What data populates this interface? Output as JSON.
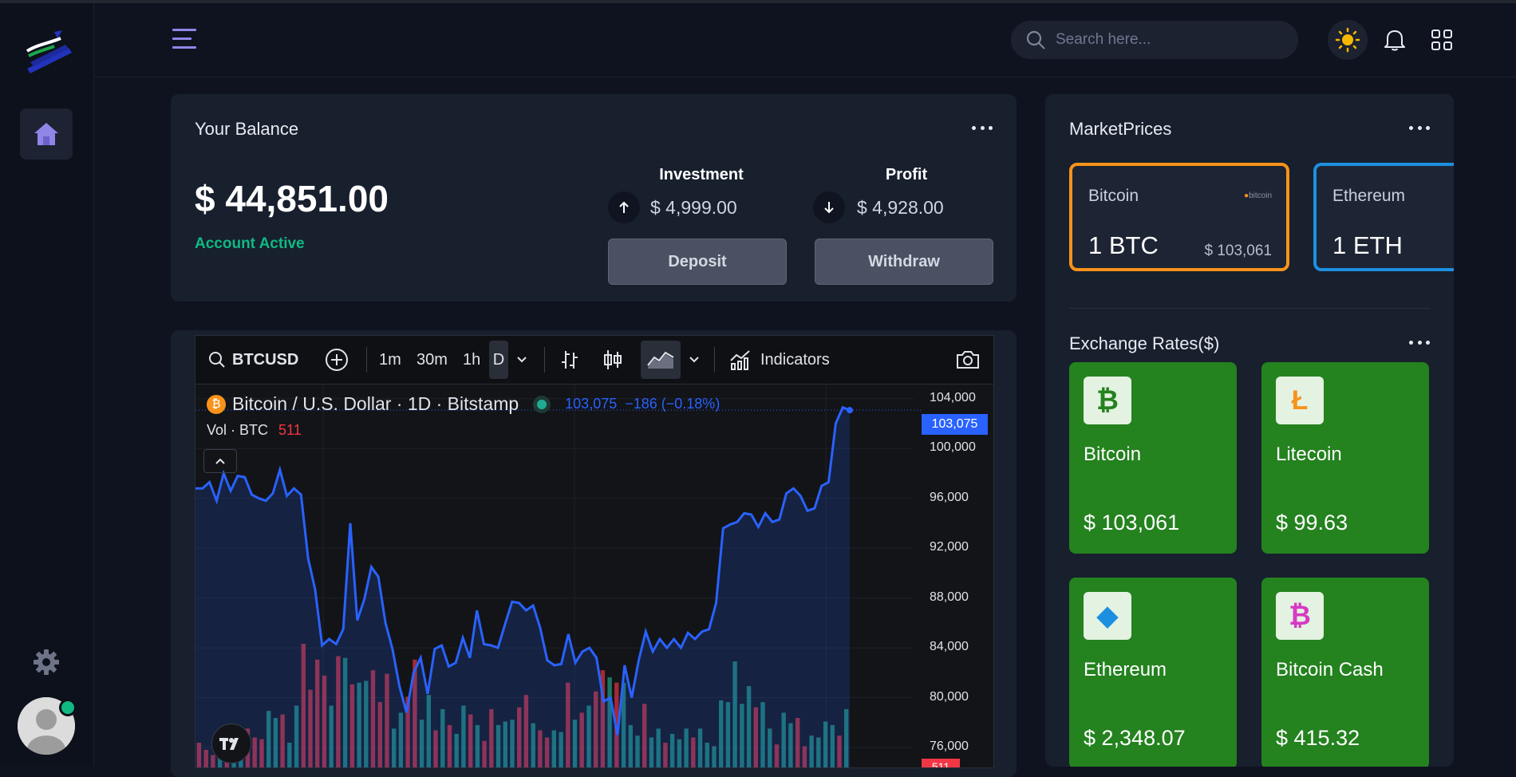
{
  "header": {
    "search_placeholder": "Search here..."
  },
  "balance": {
    "title": "Your Balance",
    "amount": "$ 44,851.00",
    "status": "Account Active",
    "investment_label": "Investment",
    "investment_value": "$ 4,999.00",
    "profit_label": "Profit",
    "profit_value": "$ 4,928.00",
    "deposit_label": "Deposit",
    "withdraw_label": "Withdraw"
  },
  "chart_widget": {
    "symbol": "BTCUSD",
    "intervals": [
      "1m",
      "30m",
      "1h",
      "D"
    ],
    "active_interval": "D",
    "indicators_label": "Indicators",
    "legend_title": "Bitcoin / U.S. Dollar · 1D · Bitstamp",
    "legend_quote": "103,075  −186 (−0.18%)",
    "volume_label": "Vol · BTC",
    "volume_value": "511",
    "last_price_tag": "103,075",
    "volume_tag": "511",
    "line_color": "#2962ff",
    "up_color": "#22ab94",
    "down_color": "#f23645"
  },
  "chart_data": {
    "type": "line",
    "title": "Bitcoin / U.S. Dollar · 1D · Bitstamp",
    "xlabel": "",
    "ylabel": "",
    "ylim": [
      74400,
      105200
    ],
    "y_ticks": [
      "104,000",
      "100,000",
      "96,000",
      "92,000",
      "88,000",
      "84,000",
      "80,000",
      "76,000"
    ],
    "series": [
      {
        "values": [
          96800,
          96800,
          97300,
          95800,
          98000,
          96600,
          97800,
          97700,
          96300,
          96000,
          95800,
          96400,
          98300,
          96200,
          96800,
          96300,
          91200,
          88700,
          84200,
          84700,
          84300,
          85500,
          94000,
          86200,
          87900,
          90500,
          89700,
          86000,
          83900,
          80900,
          78800,
          82000,
          83200,
          80300,
          83900,
          84200,
          82500,
          82800,
          84800,
          83200,
          87000,
          84300,
          84200,
          84000,
          85900,
          87700,
          87600,
          87000,
          87400,
          85600,
          83000,
          82600,
          82700,
          85100,
          82800,
          83700,
          84000,
          83200,
          79700,
          80000,
          77000,
          82600,
          80000,
          83000,
          85300,
          83700,
          84700,
          84000,
          84700,
          84000,
          85200,
          84700,
          85300,
          85500,
          87600,
          93600,
          93900,
          94100,
          94800,
          94700,
          93700,
          94800,
          94100,
          94300,
          96400,
          96800,
          96200,
          95000,
          95200,
          97000,
          97300,
          102000,
          103300,
          103075
        ]
      }
    ],
    "volume": {
      "values": [
        14,
        10,
        7,
        16,
        13,
        10,
        20,
        22,
        17,
        16,
        32,
        28,
        30,
        14,
        35,
        70,
        44,
        61,
        52,
        35,
        63,
        62,
        47,
        48,
        49,
        55,
        37,
        53,
        22,
        31,
        40,
        61,
        27,
        41,
        21,
        33,
        24,
        19,
        35,
        30,
        24,
        15,
        33,
        24,
        26,
        27,
        34,
        41,
        25,
        21,
        17,
        21,
        20,
        48,
        27,
        31,
        35,
        43,
        55,
        51,
        48,
        48,
        24,
        18,
        36,
        17,
        22,
        14,
        19,
        16,
        22,
        17,
        22,
        14,
        12,
        38,
        37,
        60,
        36,
        46,
        34,
        37,
        22,
        13,
        31,
        25,
        28,
        12,
        18,
        17,
        26,
        24,
        18,
        33
      ],
      "colors": [
        "r",
        "r",
        "r",
        "g",
        "r",
        "g",
        "g",
        "r",
        "r",
        "r",
        "g",
        "g",
        "r",
        "g",
        "g",
        "r",
        "r",
        "r",
        "r",
        "g",
        "r",
        "g",
        "r",
        "g",
        "g",
        "r",
        "r",
        "r",
        "g",
        "g",
        "r",
        "r",
        "g",
        "g",
        "r",
        "g",
        "r",
        "g",
        "g",
        "r",
        "g",
        "r",
        "r",
        "g",
        "g",
        "g",
        "r",
        "r",
        "g",
        "r",
        "r",
        "g",
        "g",
        "r",
        "g",
        "r",
        "g",
        "r",
        "r",
        "g",
        "r",
        "g",
        "g",
        "g",
        "r",
        "g",
        "g",
        "r",
        "g",
        "g",
        "g",
        "r",
        "g",
        "g",
        "g",
        "g",
        "g",
        "g",
        "g",
        "g",
        "r",
        "g",
        "g",
        "r",
        "g",
        "g",
        "r",
        "r",
        "g",
        "g",
        "g",
        "g",
        "r",
        "g"
      ]
    }
  },
  "market": {
    "title": "MarketPrices",
    "coins": [
      {
        "name": "Bitcoin",
        "amount": "1 BTC",
        "price": "$ 103,061",
        "brand": "bitcoin",
        "border": "#f7931a"
      },
      {
        "name": "Ethereum",
        "amount": "1 ETH",
        "price": "$",
        "border": "#1d8fe0"
      }
    ]
  },
  "exchange": {
    "title": "Exchange Rates($)",
    "tiles": [
      {
        "glyph": "₿",
        "name": "Bitcoin",
        "price": "$ 103,061",
        "icon_color": "#24821f",
        "icon": "bitcoin-icon"
      },
      {
        "glyph": "Ł",
        "name": "Litecoin",
        "price": "$ 99.63",
        "icon_color": "#f7931a",
        "icon": "litecoin-icon"
      },
      {
        "glyph": "◆",
        "name": "Ethereum",
        "price": "$ 2,348.07",
        "icon_color": "#1d8fe0",
        "icon": "ethereum-icon"
      },
      {
        "glyph": "₿",
        "name": "Bitcoin Cash",
        "price": "$ 415.32",
        "icon_color": "#d63ac2",
        "icon": "bitcoin-cash-icon"
      }
    ]
  }
}
